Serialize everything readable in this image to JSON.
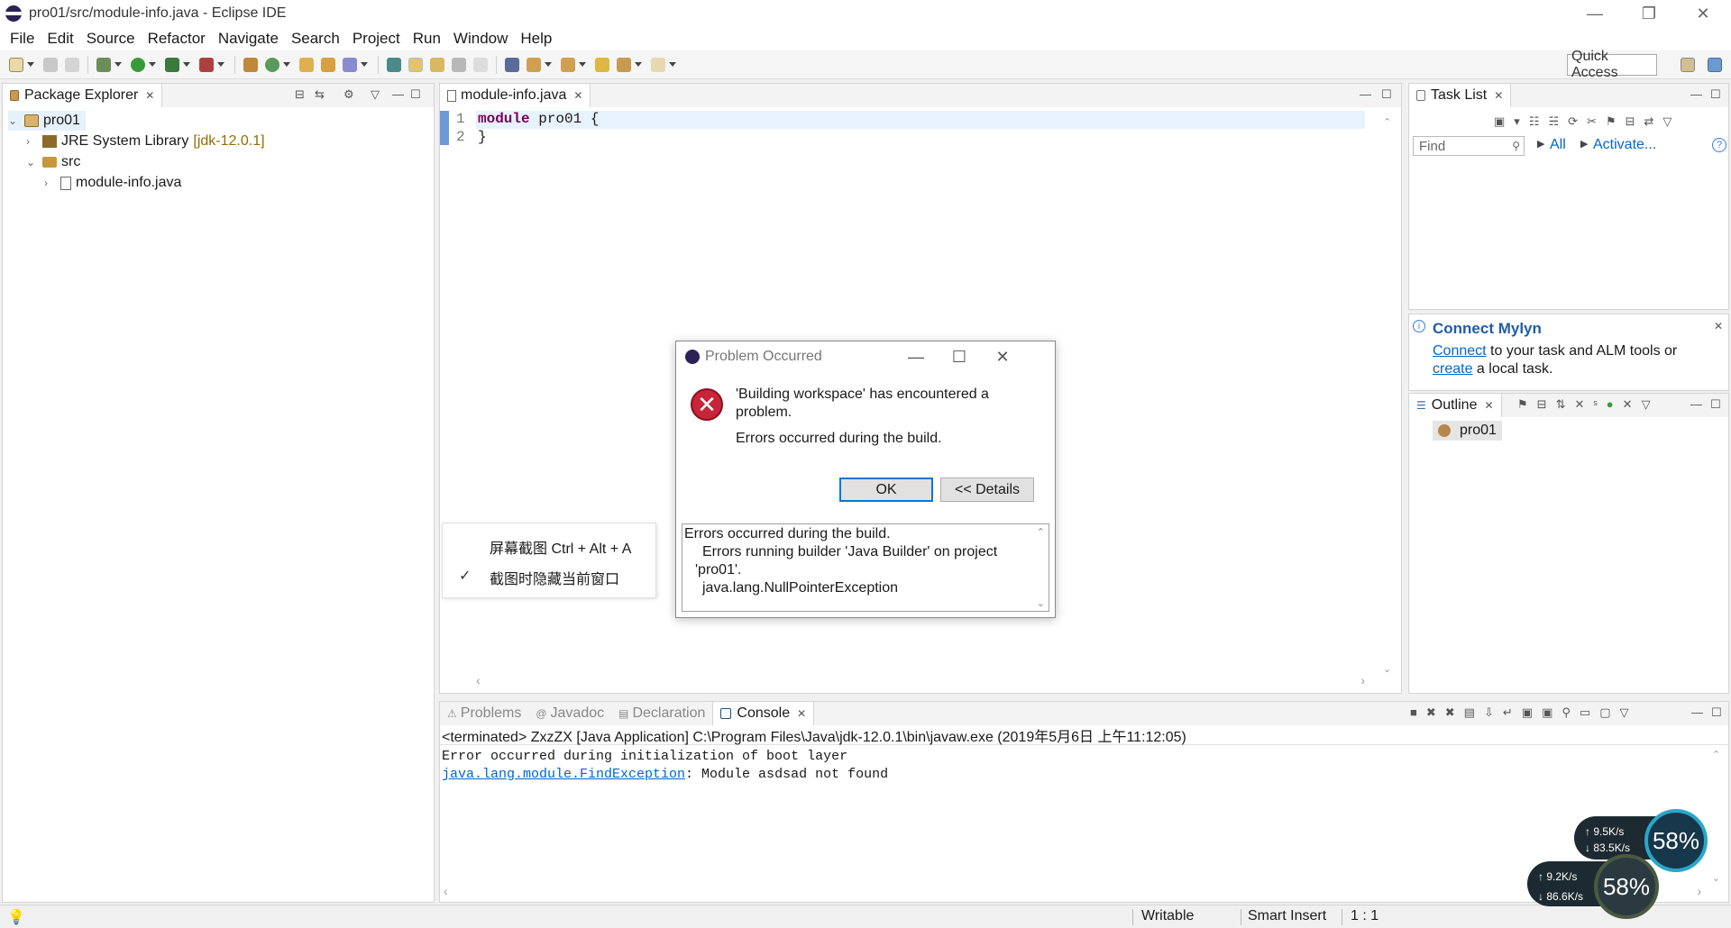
{
  "window": {
    "title": "pro01/src/module-info.java - Eclipse IDE",
    "minimize": "—",
    "restore": "❐",
    "close": "✕"
  },
  "menu": [
    "File",
    "Edit",
    "Source",
    "Refactor",
    "Navigate",
    "Search",
    "Project",
    "Run",
    "Window",
    "Help"
  ],
  "toolbar": {
    "quick_access": "Quick Access"
  },
  "package_explorer": {
    "tab_label": "Package Explorer",
    "tree": {
      "project": "pro01",
      "jre": "JRE System Library",
      "jre_version": "[jdk-12.0.1]",
      "src": "src",
      "file": "module-info.java"
    }
  },
  "editor": {
    "tab_label": "module-info.java",
    "lines": [
      {
        "num": "1",
        "keyword": "module",
        "rest": " pro01 {"
      },
      {
        "num": "2",
        "keyword": "",
        "rest": "}"
      }
    ]
  },
  "task_list": {
    "tab_label": "Task List",
    "find_placeholder": "Find",
    "all_label": "All",
    "activate_label": "Activate..."
  },
  "mylyn": {
    "title": "Connect Mylyn",
    "connect_link": "Connect",
    "text1": " to your task and ALM tools or",
    "create_link": "create",
    "text2": " a local task."
  },
  "outline": {
    "tab_label": "Outline",
    "item": "pro01"
  },
  "console_view": {
    "tabs": [
      "Problems",
      "Javadoc",
      "Declaration",
      "Console"
    ],
    "header": "<terminated> ZxzZX [Java Application] C:\\Program Files\\Java\\jdk-12.0.1\\bin\\javaw.exe (2019年5月6日 上午11:12:05)",
    "line1": "Error occurred during initialization of boot layer",
    "link": "java.lang.module.FindException",
    "line2_rest": ": Module asdsad not found"
  },
  "status_bar": {
    "writable": "Writable",
    "insert_mode": "Smart Insert",
    "position": "1 : 1"
  },
  "context_menu": {
    "item1": "屏幕截图 Ctrl + Alt + A",
    "item2": "截图时隐藏当前窗口"
  },
  "dialog": {
    "title": "Problem Occurred",
    "message1": "'Building workspace' has encountered a",
    "message2": "problem.",
    "message3": "Errors occurred during the build.",
    "ok": "OK",
    "details": "<< Details",
    "details_lines": [
      "Errors occurred during the build.",
      "Errors running builder 'Java Builder' on project",
      "'pro01'.",
      "java.lang.NullPointerException"
    ]
  },
  "network_widget": {
    "up1": "9.5K/s",
    "down1": "83.5K/s",
    "pct1": "58%",
    "up2": "9.2K/s",
    "down2": "86.6K/s",
    "pct2": "58%"
  },
  "colors": {
    "link": "#0066cc",
    "keyword": "#7f0055",
    "error_red": "#c8243a",
    "widget_ring": "#2ba6c9"
  }
}
